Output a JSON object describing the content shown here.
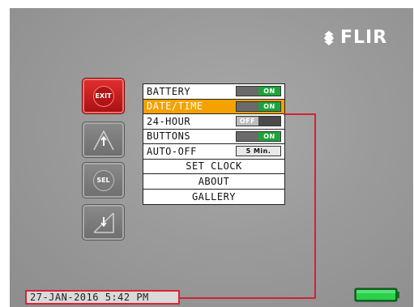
{
  "brand": {
    "name": "FLIR"
  },
  "side_buttons": {
    "exit_label": "EXIT",
    "up": "arrow-up-icon",
    "sel_label": "SEL",
    "down": "arrow-down-icon"
  },
  "menu": {
    "items": [
      {
        "label": "BATTERY",
        "control": "toggle",
        "state": "ON"
      },
      {
        "label": "DATE/TIME",
        "control": "toggle",
        "state": "ON",
        "highlighted": true
      },
      {
        "label": "24-HOUR",
        "control": "toggle",
        "state": "OFF"
      },
      {
        "label": "BUTTONS",
        "control": "toggle",
        "state": "ON"
      },
      {
        "label": "AUTO-OFF",
        "control": "value",
        "value": "5 Min."
      },
      {
        "label": "SET CLOCK",
        "control": "none"
      },
      {
        "label": "ABOUT",
        "control": "none"
      },
      {
        "label": "GALLERY",
        "control": "none"
      }
    ]
  },
  "status_bar": {
    "datetime": "27-JAN-2016  5:42 PM"
  },
  "battery": {
    "level": 1.0,
    "color": "#2ad14a"
  },
  "colors": {
    "highlight": "#f5a100",
    "toggle_on": "#1ea33a",
    "callout": "#d22233"
  }
}
